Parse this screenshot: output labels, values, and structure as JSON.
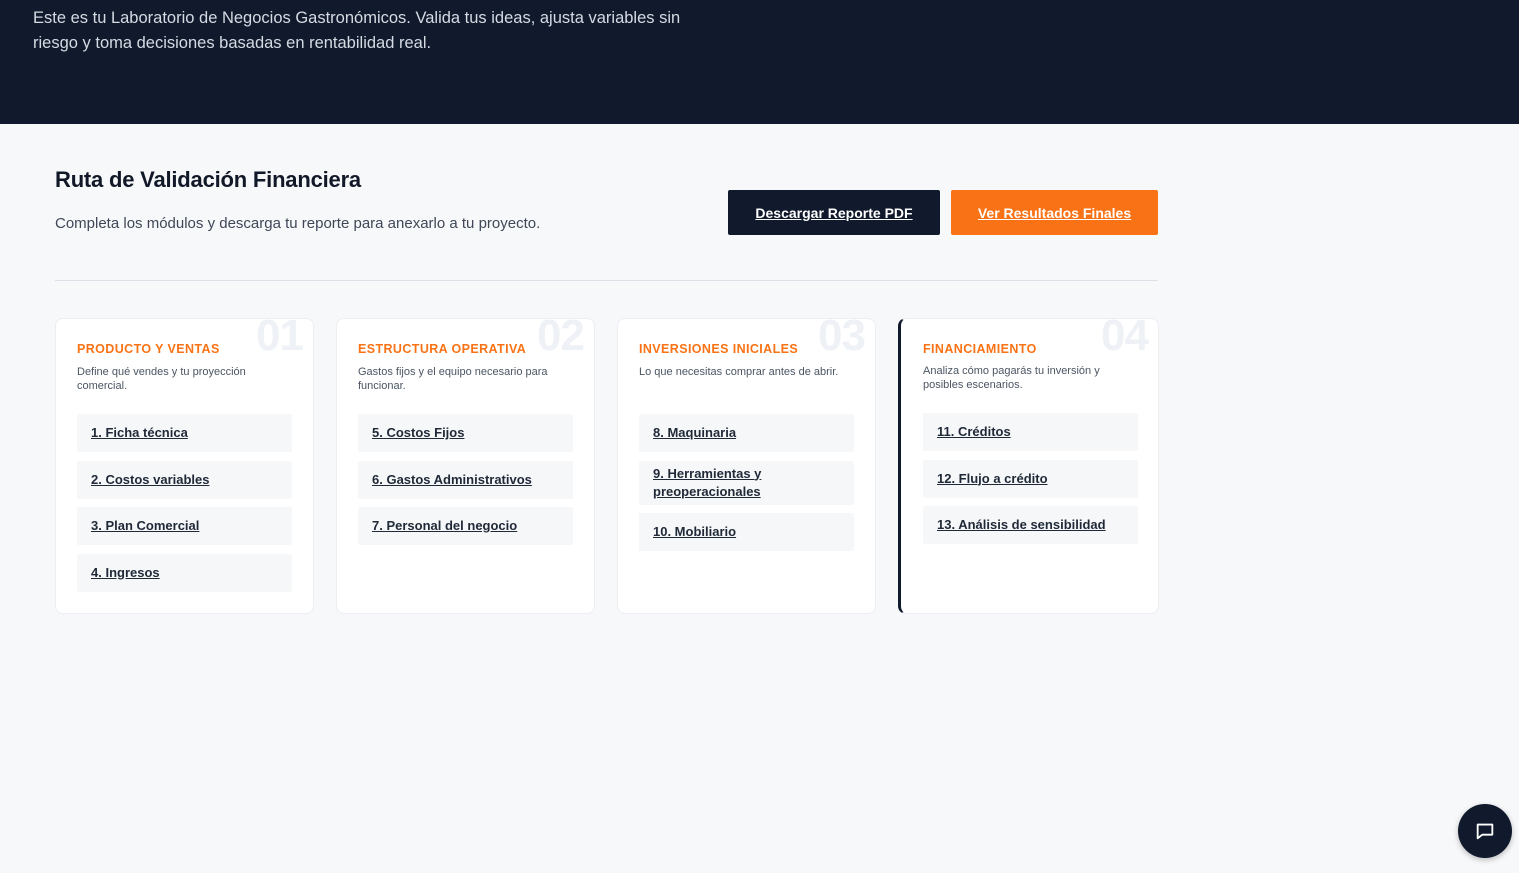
{
  "hero": {
    "text": "Este es tu Laboratorio de Negocios Gastronómicos. Valida tus ideas, ajusta variables sin riesgo y toma decisiones basadas en rentabilidad real."
  },
  "section": {
    "title": "Ruta de Validación Financiera",
    "subtitle": "Completa los módulos y descarga tu reporte para anexarlo a tu proyecto."
  },
  "actions": {
    "download_label": "Descargar Reporte PDF",
    "results_label": "Ver Resultados Finales"
  },
  "colors": {
    "accent": "#f97316",
    "dark": "#111a2c",
    "background": "#f7f8fa"
  },
  "modules": [
    {
      "number": "01",
      "title": "PRODUCTO Y VENTAS",
      "description": "Define qué vendes y tu proyección comercial.",
      "links": [
        "1. Ficha técnica",
        "2. Costos variables",
        "3. Plan Comercial",
        "4. Ingresos"
      ]
    },
    {
      "number": "02",
      "title": "ESTRUCTURA OPERATIVA",
      "description": "Gastos fijos y el equipo necesario para funcionar.",
      "links": [
        "5. Costos Fijos",
        "6. Gastos Administrativos",
        "7. Personal del negocio"
      ]
    },
    {
      "number": "03",
      "title": "INVERSIONES INICIALES",
      "description": "Lo que necesitas comprar antes de abrir.",
      "links": [
        "8. Maquinaria",
        "9. Herramientas y preoperacionales",
        "10. Mobiliario"
      ]
    },
    {
      "number": "04",
      "title": "FINANCIAMIENTO",
      "description": "Analiza cómo pagarás tu inversión y posibles escenarios.",
      "links": [
        "11. Créditos",
        "12. Flujo a crédito",
        "13. Análisis de sensibilidad"
      ]
    }
  ],
  "chat": {
    "icon": "chat-bubble-icon"
  }
}
